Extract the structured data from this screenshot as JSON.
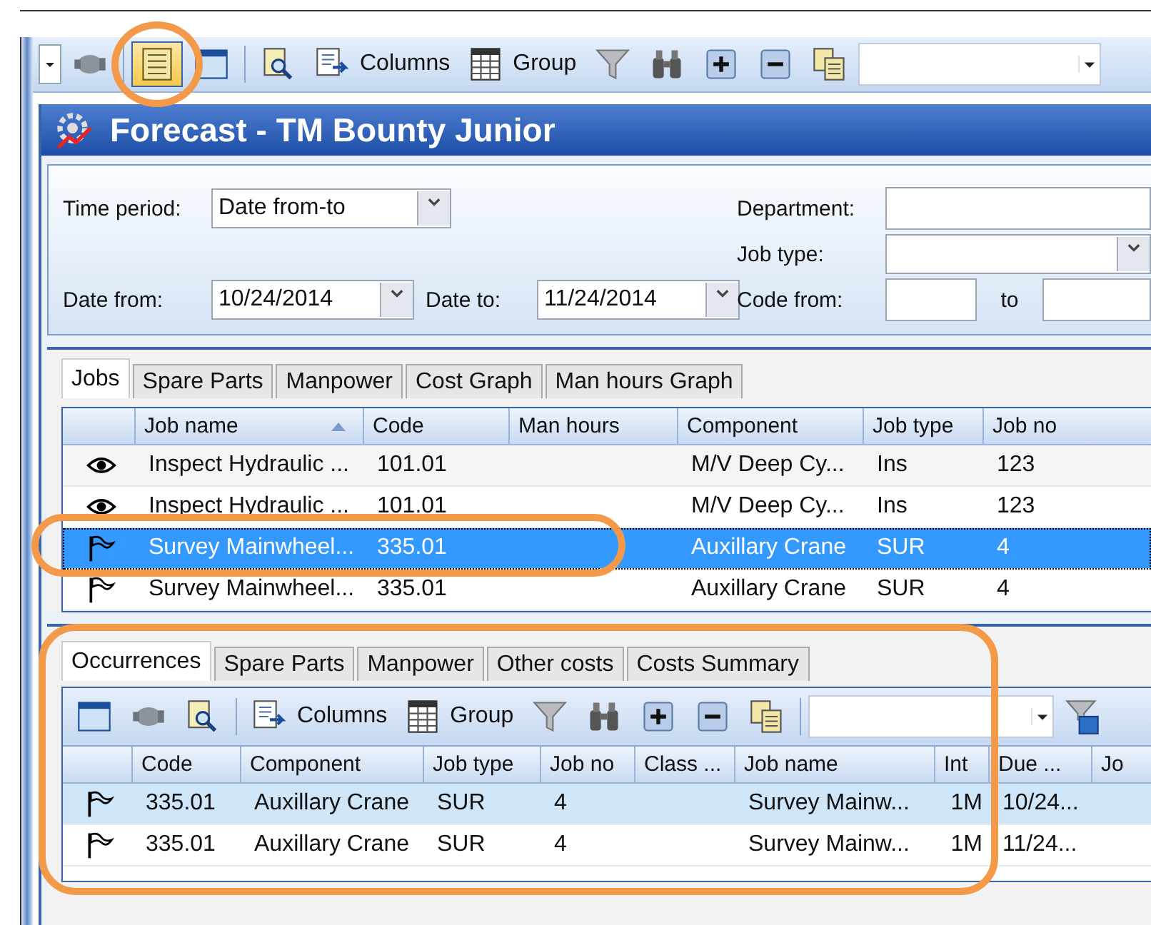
{
  "toolbar": {
    "items": [
      {
        "kind": "dropdown",
        "pressed": false
      },
      {
        "kind": "motor",
        "pressed": false
      },
      {
        "kind": "list",
        "pressed": true,
        "circled": true
      },
      {
        "kind": "window",
        "pressed": false
      },
      {
        "kind": "search-doc",
        "pressed": false
      },
      {
        "kind": "columns",
        "label": "Columns",
        "pressed": false
      },
      {
        "kind": "grid",
        "label": "Group",
        "pressed": false
      },
      {
        "kind": "filter",
        "pressed": false
      },
      {
        "kind": "binoculars",
        "pressed": false
      },
      {
        "kind": "plus",
        "pressed": false
      },
      {
        "kind": "minus",
        "pressed": false
      },
      {
        "kind": "copy",
        "pressed": false
      },
      {
        "kind": "combo",
        "pressed": false
      }
    ]
  },
  "window": {
    "title": "Forecast - TM Bounty Junior"
  },
  "filters": {
    "time_period": {
      "label": "Time period:",
      "value": "Date from-to"
    },
    "date_from": {
      "label": "Date from:",
      "value": "10/24/2014"
    },
    "date_to": {
      "label": "Date to:",
      "value": "11/24/2014"
    },
    "department": {
      "label": "Department:"
    },
    "job_type": {
      "label": "Job type:"
    },
    "code_from": {
      "label": "Code from:",
      "to_label": "to"
    }
  },
  "jobs_tabs": [
    {
      "label": "Jobs",
      "selected": true
    },
    {
      "label": "Spare Parts",
      "selected": false
    },
    {
      "label": "Manpower",
      "selected": false
    },
    {
      "label": "Cost Graph",
      "selected": false
    },
    {
      "label": "Man hours Graph",
      "selected": false
    }
  ],
  "jobs_table": {
    "columns": [
      {
        "label": "Job name",
        "sorted": true
      },
      {
        "label": "Code",
        "sorted": false
      },
      {
        "label": "Man hours",
        "sorted": false
      },
      {
        "label": "Component",
        "sorted": false
      },
      {
        "label": "Job type",
        "sorted": false
      },
      {
        "label": "Job no",
        "sorted": false
      }
    ],
    "rows": [
      {
        "kind": "eye",
        "selected": false,
        "circled": false,
        "cells": [
          "Inspect Hydraulic ...",
          "101.01",
          null,
          "M/V Deep Cy...",
          "Ins",
          "123"
        ]
      },
      {
        "kind": "eye",
        "selected": false,
        "circled": false,
        "cells": [
          "Inspect Hydraulic ...",
          "101.01",
          null,
          "M/V Deep Cy...",
          "Ins",
          "123"
        ]
      },
      {
        "kind": "flag",
        "selected": true,
        "circled": true,
        "cells": [
          "Survey Mainwheel...",
          "335.01",
          null,
          "Auxillary Crane",
          "SUR",
          "4"
        ]
      },
      {
        "kind": "flag",
        "selected": false,
        "circled": false,
        "cells": [
          "Survey Mainwheel...",
          "335.01",
          null,
          "Auxillary Crane",
          "SUR",
          "4"
        ]
      }
    ]
  },
  "occurrences_panel": {
    "circled": true,
    "tabs": [
      {
        "label": "Occurrences",
        "selected": true
      },
      {
        "label": "Spare Parts",
        "selected": false
      },
      {
        "label": "Manpower",
        "selected": false
      },
      {
        "label": "Other costs",
        "selected": false
      },
      {
        "label": "Costs Summary",
        "selected": false
      }
    ],
    "toolbar": {
      "items": [
        {
          "kind": "window",
          "pressed": false
        },
        {
          "kind": "motor",
          "pressed": false
        },
        {
          "kind": "search-doc",
          "pressed": false
        },
        {
          "kind": "columns",
          "label": "Columns",
          "pressed": false
        },
        {
          "kind": "grid",
          "label": "Group",
          "pressed": false
        },
        {
          "kind": "filter",
          "pressed": false
        },
        {
          "kind": "binoculars",
          "pressed": false
        },
        {
          "kind": "plus",
          "pressed": false
        },
        {
          "kind": "minus",
          "pressed": false
        },
        {
          "kind": "copy",
          "pressed": false
        },
        {
          "kind": "combo",
          "pressed": false
        },
        {
          "kind": "filter-save",
          "pressed": false
        }
      ]
    },
    "table": {
      "columns": [
        {
          "label": "Code"
        },
        {
          "label": "Component"
        },
        {
          "label": "Job type"
        },
        {
          "label": "Job no"
        },
        {
          "label": "Class ..."
        },
        {
          "label": "Job name"
        },
        {
          "label": "Int"
        },
        {
          "label": "Due ..."
        },
        {
          "label": "Jo"
        }
      ],
      "rows": [
        {
          "kind": "flag",
          "selected": true,
          "cells": [
            "335.01",
            "Auxillary Crane",
            "SUR",
            "4",
            null,
            "Survey Mainw...",
            "1M",
            "10/24..."
          ]
        },
        {
          "kind": "flag",
          "selected": false,
          "cells": [
            "335.01",
            "Auxillary Crane",
            "SUR",
            "4",
            null,
            "Survey Mainw...",
            "1M",
            "11/24..."
          ]
        }
      ]
    }
  }
}
